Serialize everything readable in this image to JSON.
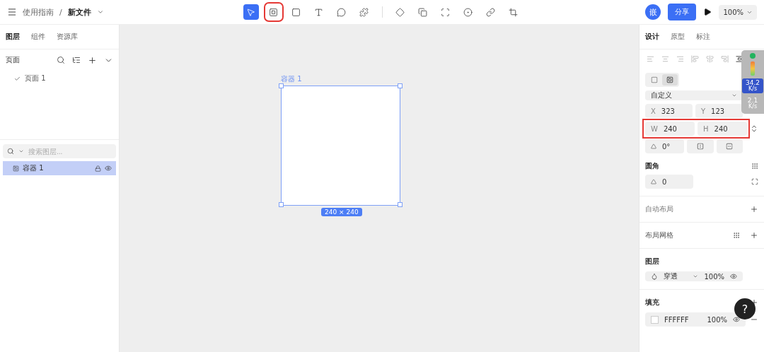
{
  "topbar": {
    "breadcrumb": "使用指南",
    "separator": "/",
    "file_name": "新文件",
    "avatar": "嵌",
    "share_button": "分享",
    "zoom": "100%",
    "tools": [
      {
        "kind": "select",
        "selected": true,
        "highlighted": false
      },
      {
        "kind": "container",
        "selected": false,
        "highlighted": true
      },
      {
        "kind": "rect",
        "selected": false,
        "highlighted": false
      },
      {
        "kind": "text",
        "selected": false,
        "highlighted": false
      },
      {
        "kind": "bubble",
        "selected": false,
        "highlighted": false
      },
      {
        "kind": "shape",
        "selected": false,
        "highlighted": false
      },
      {
        "kind": "divider"
      },
      {
        "kind": "component",
        "selected": false,
        "highlighted": false
      },
      {
        "kind": "boolean",
        "selected": false,
        "highlighted": false
      },
      {
        "kind": "frame",
        "selected": false,
        "highlighted": false
      },
      {
        "kind": "mask",
        "selected": false,
        "highlighted": false
      },
      {
        "kind": "link",
        "selected": false,
        "highlighted": false
      },
      {
        "kind": "crop",
        "selected": false,
        "highlighted": false
      }
    ]
  },
  "left_panel": {
    "tabs": [
      {
        "label": "图层",
        "selected": true
      },
      {
        "label": "组件",
        "selected": false
      },
      {
        "label": "资源库",
        "selected": false
      }
    ],
    "pages_title": "页面",
    "pages": [
      {
        "label": "页面 1",
        "selected": true
      }
    ],
    "layer_search": {
      "placeholder": "搜索图层..."
    },
    "layers": [
      {
        "name": "容器 1",
        "selected": true
      }
    ]
  },
  "canvas": {
    "frame_label": "容器 1",
    "size_badge": "240 × 240"
  },
  "right_panel": {
    "tabs": [
      {
        "label": "设计",
        "selected": true
      },
      {
        "label": "原型",
        "selected": false
      },
      {
        "label": "标注",
        "selected": false
      }
    ],
    "frame_modes": [
      {
        "kind": "clip",
        "selected": false
      },
      {
        "kind": "fill",
        "selected": true
      }
    ],
    "preset": "自定义",
    "fields": [
      {
        "label": "X",
        "value": "323"
      },
      {
        "label": "Y",
        "value": "123"
      },
      {
        "label": "W",
        "value": "240"
      },
      {
        "label": "H",
        "value": "240"
      }
    ],
    "size_row_highlighted": true,
    "rotation": "0°",
    "radius_title": "圆角",
    "radius": "0",
    "auto_layout_title": "自动布局",
    "grid_title": "布局网格",
    "layer_title": "图层",
    "blend": "穿透",
    "layer_opacity": "100%",
    "fill_title": "填充",
    "fill_color": "FFFFFF",
    "fill_opacity": "100%"
  },
  "net_widget": {
    "upload": "34.2",
    "upload_unit": "K/s",
    "download": "2.1",
    "download_unit": "K/s"
  },
  "help_button": "?"
}
